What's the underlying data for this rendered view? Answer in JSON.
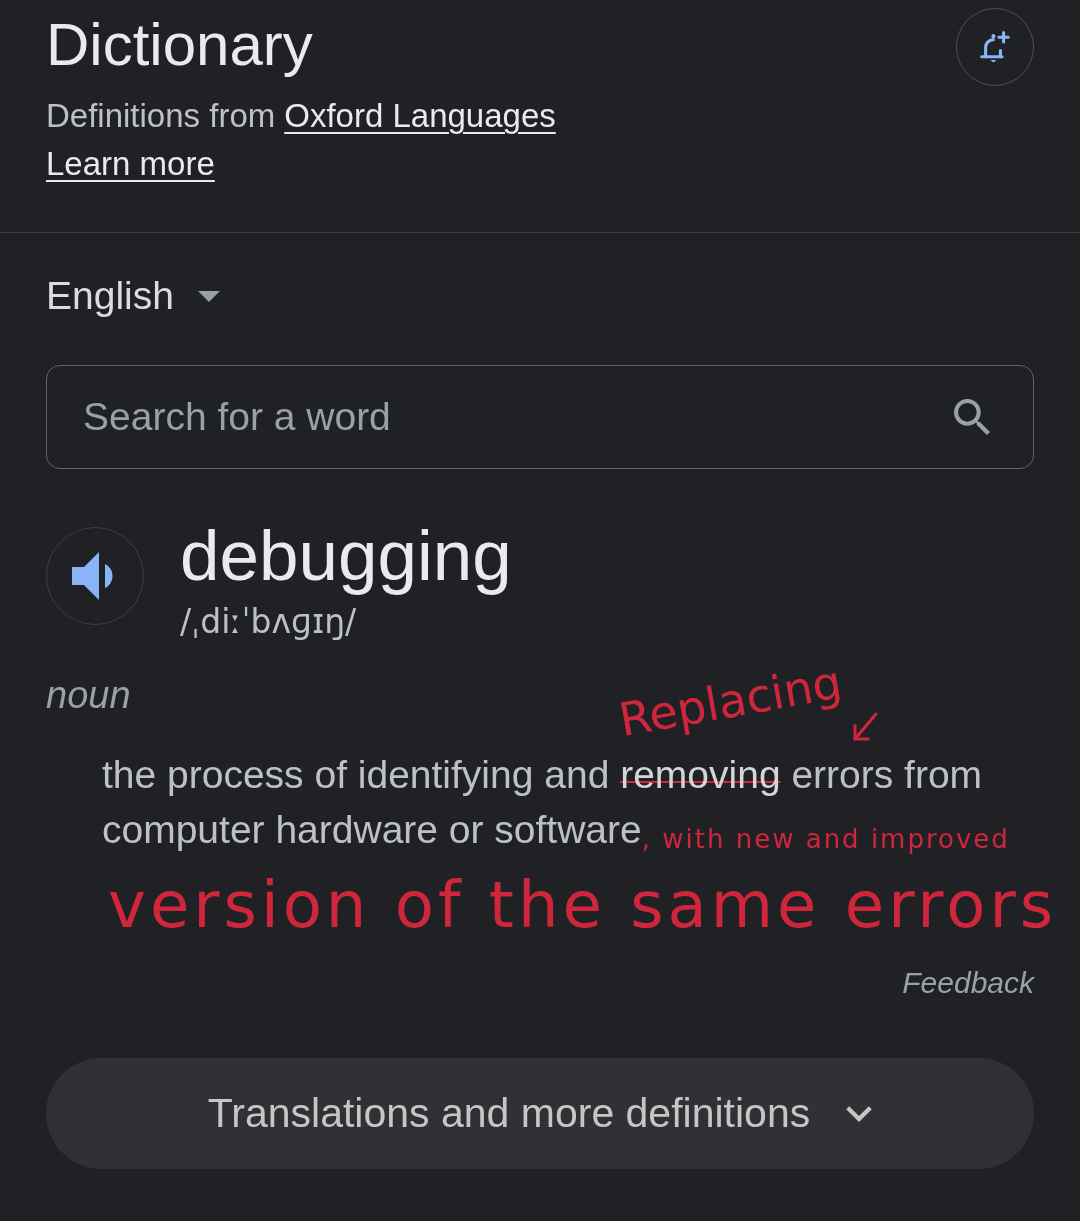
{
  "header": {
    "title": "Dictionary",
    "source_label": "Definitions from",
    "source_link": "Oxford Languages",
    "learn_more": "Learn more"
  },
  "language": {
    "label": "English"
  },
  "search": {
    "placeholder": "Search for a word"
  },
  "entry": {
    "word": "debugging",
    "phonetic": "/ˌdiːˈbʌɡɪŋ/",
    "part_of_speech": "noun",
    "definition": [
      {
        "kind": "printed",
        "text": "the process of identifying and ",
        "struck": false
      },
      {
        "kind": "printed",
        "text": "removing",
        "struck": true
      },
      {
        "kind": "printed",
        "text": " errors from computer hardware or software",
        "struck": false
      },
      {
        "kind": "handwritten",
        "text": ", with new and improved",
        "struck": false
      }
    ],
    "feedback": "Feedback"
  },
  "annotations": [
    {
      "kind": "correction",
      "text": "Replacing"
    },
    {
      "kind": "line",
      "text": "version of the same errors"
    }
  ],
  "more_button": {
    "label": "Translations and more definitions"
  }
}
